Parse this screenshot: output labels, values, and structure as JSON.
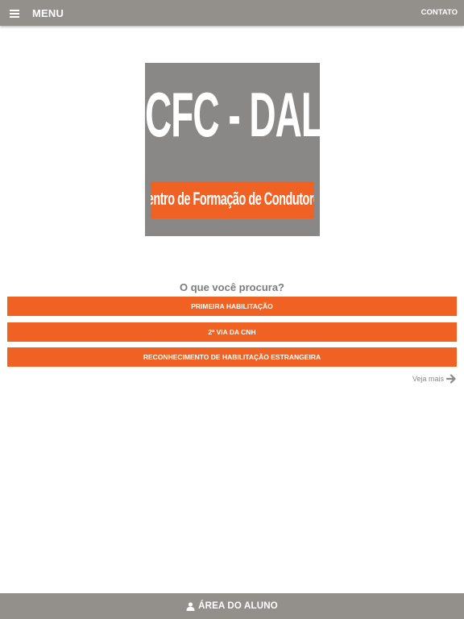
{
  "header": {
    "menu_label": "MENU",
    "menu_icon": "hamburger-icon",
    "contact_label": "CONTATO",
    "background": "#938f8b"
  },
  "logo": {
    "title": "CFC - DAL PONTE",
    "subtitle": "Centro de Formação de Condutores",
    "background": "#8a8887",
    "accent": "#ef6224"
  },
  "main": {
    "question": "O que você procura?",
    "options": [
      "PRIMEIRA HABILITAÇÃO",
      "2ª VIA DA CNH",
      "RECONHECIMENTO DE HABILITAÇÃO ESTRANGEIRA"
    ],
    "see_more": "Veja mais",
    "see_more_icon": "arrow-right-icon"
  },
  "footer": {
    "label": "ÁREA DO ALUNO",
    "icon": "user-icon"
  },
  "colors": {
    "accent": "#ef6224",
    "bar": "#938f8b",
    "text_muted": "#7c7c7c"
  }
}
